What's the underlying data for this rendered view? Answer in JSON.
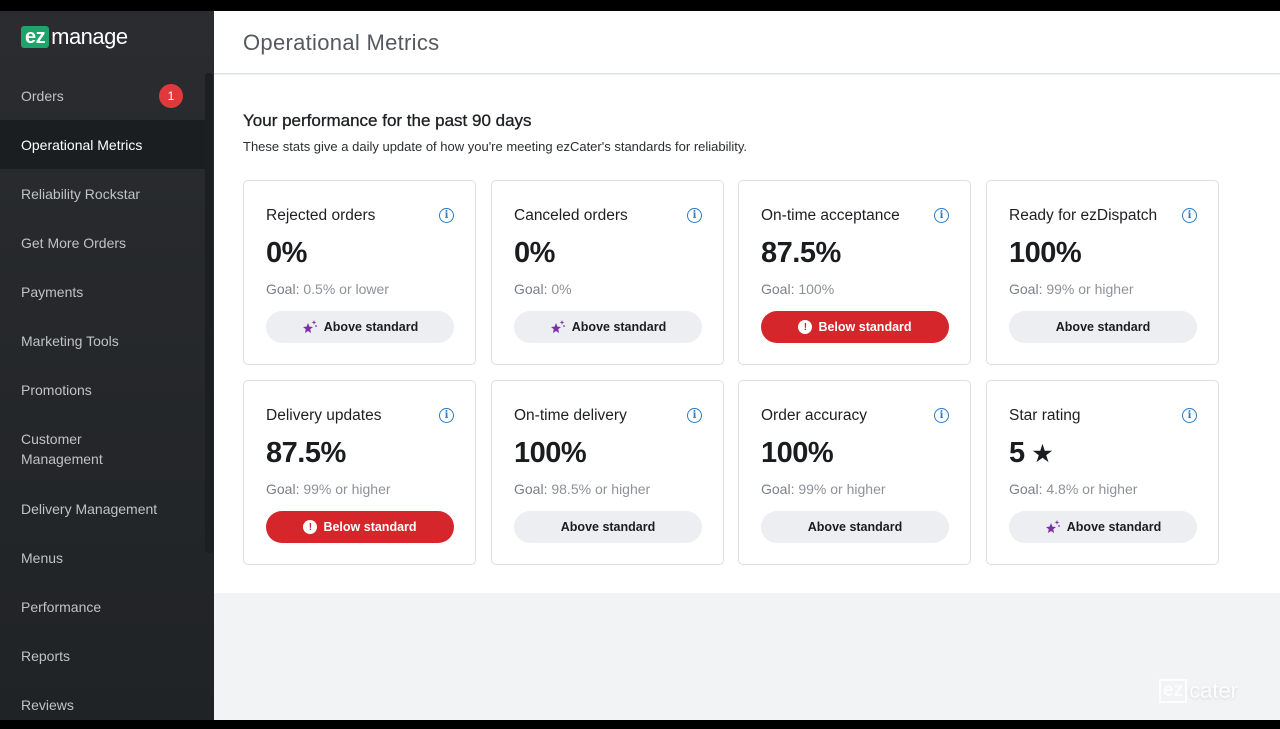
{
  "app": {
    "logo_prefix": "ez",
    "logo_suffix": "manage",
    "watermark_prefix": "ez",
    "watermark_suffix": "cater"
  },
  "sidebar": {
    "items": [
      {
        "label": "Orders",
        "badge": "1"
      },
      {
        "label": "Operational Metrics",
        "active": true
      },
      {
        "label": "Reliability Rockstar"
      },
      {
        "label": "Get More Orders"
      },
      {
        "label": "Payments"
      },
      {
        "label": "Marketing Tools"
      },
      {
        "label": "Promotions"
      },
      {
        "label": "Customer Management"
      },
      {
        "label": "Delivery Management"
      },
      {
        "label": "Menus"
      },
      {
        "label": "Performance"
      },
      {
        "label": "Reports"
      },
      {
        "label": "Reviews"
      }
    ]
  },
  "header": {
    "title": "Operational Metrics"
  },
  "main": {
    "heading": "Your performance for the past 90 days",
    "subheading": "These stats give a daily update of how you're meeting ezCater's standards for reliability.",
    "goal_label": "Goal:",
    "cards": [
      {
        "title": "Rejected orders",
        "value": "0%",
        "goal": "0.5% or lower",
        "status": "Above standard",
        "status_type": "above",
        "status_icon": "sparkle-star-icon"
      },
      {
        "title": "Canceled orders",
        "value": "0%",
        "goal": "0%",
        "status": "Above standard",
        "status_type": "above",
        "status_icon": "sparkle-star-icon"
      },
      {
        "title": "On-time acceptance",
        "value": "87.5%",
        "goal": "100%",
        "status": "Below standard",
        "status_type": "below",
        "status_icon": "exclamation-icon"
      },
      {
        "title": "Ready for ezDispatch",
        "value": "100%",
        "goal": "99% or higher",
        "status": "Above standard",
        "status_type": "above",
        "status_icon": ""
      },
      {
        "title": "Delivery updates",
        "value": "87.5%",
        "goal": "99% or higher",
        "status": "Below standard",
        "status_type": "below",
        "status_icon": "exclamation-icon"
      },
      {
        "title": "On-time delivery",
        "value": "100%",
        "goal": "98.5% or higher",
        "status": "Above standard",
        "status_type": "above",
        "status_icon": ""
      },
      {
        "title": "Order accuracy",
        "value": "100%",
        "goal": "99% or higher",
        "status": "Above standard",
        "status_type": "above",
        "status_icon": ""
      },
      {
        "title": "Star rating",
        "value": "5",
        "value_icon": "star-icon",
        "goal": "4.8% or higher",
        "status": "Above standard",
        "status_type": "above",
        "status_icon": "sparkle-star-icon"
      }
    ]
  },
  "colors": {
    "brand_green": "#1fa36b",
    "below_red": "#d4262b",
    "info_blue": "#2a7cc7",
    "sparkle_purple": "#7b2fa8",
    "badge_red": "#e0393c"
  }
}
